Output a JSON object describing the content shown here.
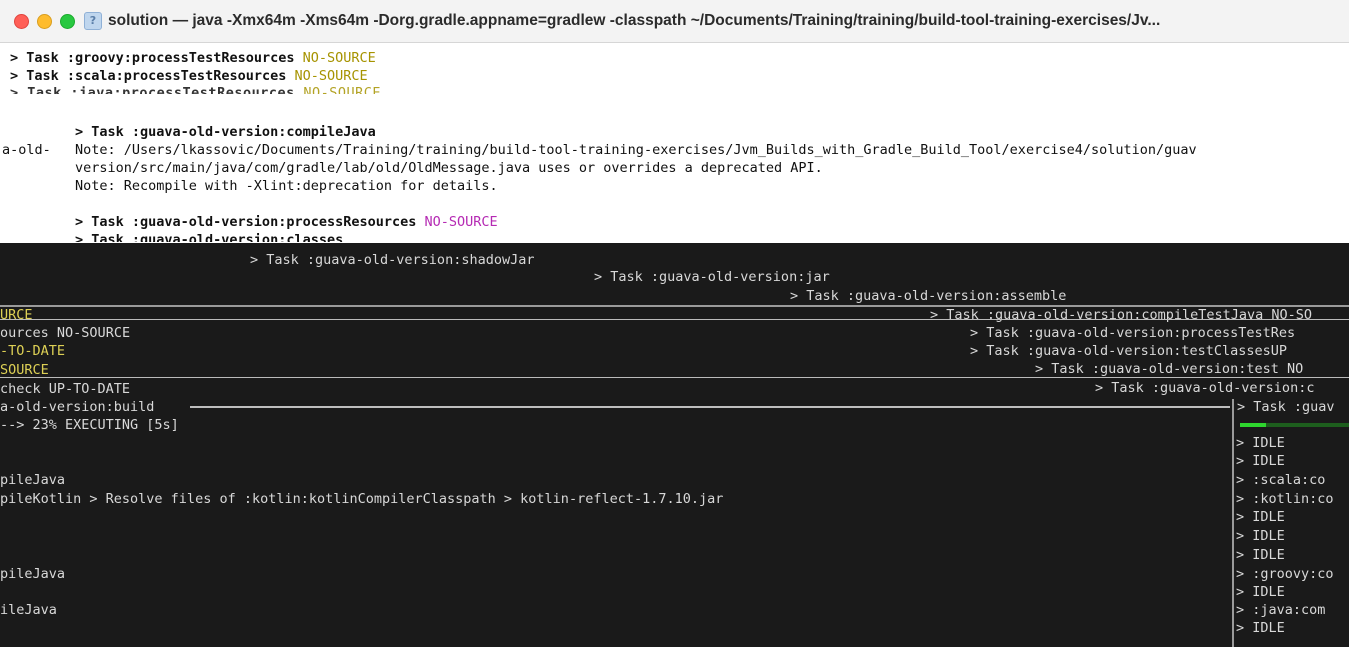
{
  "window": {
    "title": "solution — java -Xmx64m -Xms64m -Dorg.gradle.appname=gradlew -classpath ~/Documents/Training/training/build-tool-training-exercises/Jv...",
    "icon": "folder-question-icon",
    "colors": {
      "close": "#ff5f57",
      "minimize": "#febc2e",
      "maximize": "#28c840"
    }
  },
  "top_lines": [
    {
      "text": "> Task :groovy:processTestResources",
      "status": "NO-SOURCE"
    },
    {
      "text": "> Task :scala:processTestResources",
      "status": "NO-SOURCE"
    },
    {
      "text": "> Task :java:processTestResources",
      "status": "NO-SOURCE"
    }
  ],
  "compile_block": {
    "task": "> Task :guava-old-version:compileJava",
    "side_prefix": "a-old-",
    "note1": "Note: /Users/lkassovic/Documents/Training/training/build-tool-training-exercises/Jvm_Builds_with_Gradle_Build_Tool/exercise4/solution/guav",
    "note1_cont": "version/src/main/java/com/gradle/lab/old/OldMessage.java uses or overrides a deprecated API.",
    "note2": "Note: Recompile with -Xlint:deprecation for details.",
    "process_task": "> Task :guava-old-version:processResources",
    "process_status": "NO-SOURCE",
    "classes_task": "> Task :guava-old-version:classes"
  },
  "dark_lines": {
    "shadow_jar": "> Task :guava-old-version:shadowJar",
    "jar": "> Task :guava-old-version:jar",
    "assemble": "> Task :guava-old-version:assemble",
    "compile_test_java": "> Task :guava-old-version:compileTestJava",
    "compile_test_java_status": "NO-SO",
    "process_test_res": "> Task :guava-old-version:processTestRes",
    "test_classes": "> Task :guava-old-version:testClasses",
    "test_classes_status": "UP",
    "test": "> Task :guava-old-version:test",
    "test_status": "NO",
    "check_prefix": "> Task :guava-old-version:c",
    "left_nosource": "URCE",
    "left_resources": "ources",
    "left_resources_status": "NO-SOURCE",
    "left_uptodate": "-TO-DATE",
    "left_source": "SOURCE",
    "left_check": "check",
    "left_check_status": "UP-TO-DATE",
    "left_build": "a-old-version:build",
    "progress": "--> 23% EXECUTING [5s]",
    "right_task": "> Task :guav",
    "compile_java_1": "pileJava",
    "compile_kotlin": "pileKotlin > Resolve files of :kotlin:kotlinCompilerClasspath > kotlin-reflect-1.7.10.jar",
    "compile_java_2": "pileJava",
    "compile_java_3": "ileJava",
    "right_col": [
      "> IDLE",
      "> IDLE",
      "> :scala:co",
      "> :kotlin:co",
      "> IDLE",
      "> IDLE",
      "> IDLE",
      "> :groovy:co",
      "> IDLE",
      "> :java:com",
      "> IDLE"
    ]
  }
}
